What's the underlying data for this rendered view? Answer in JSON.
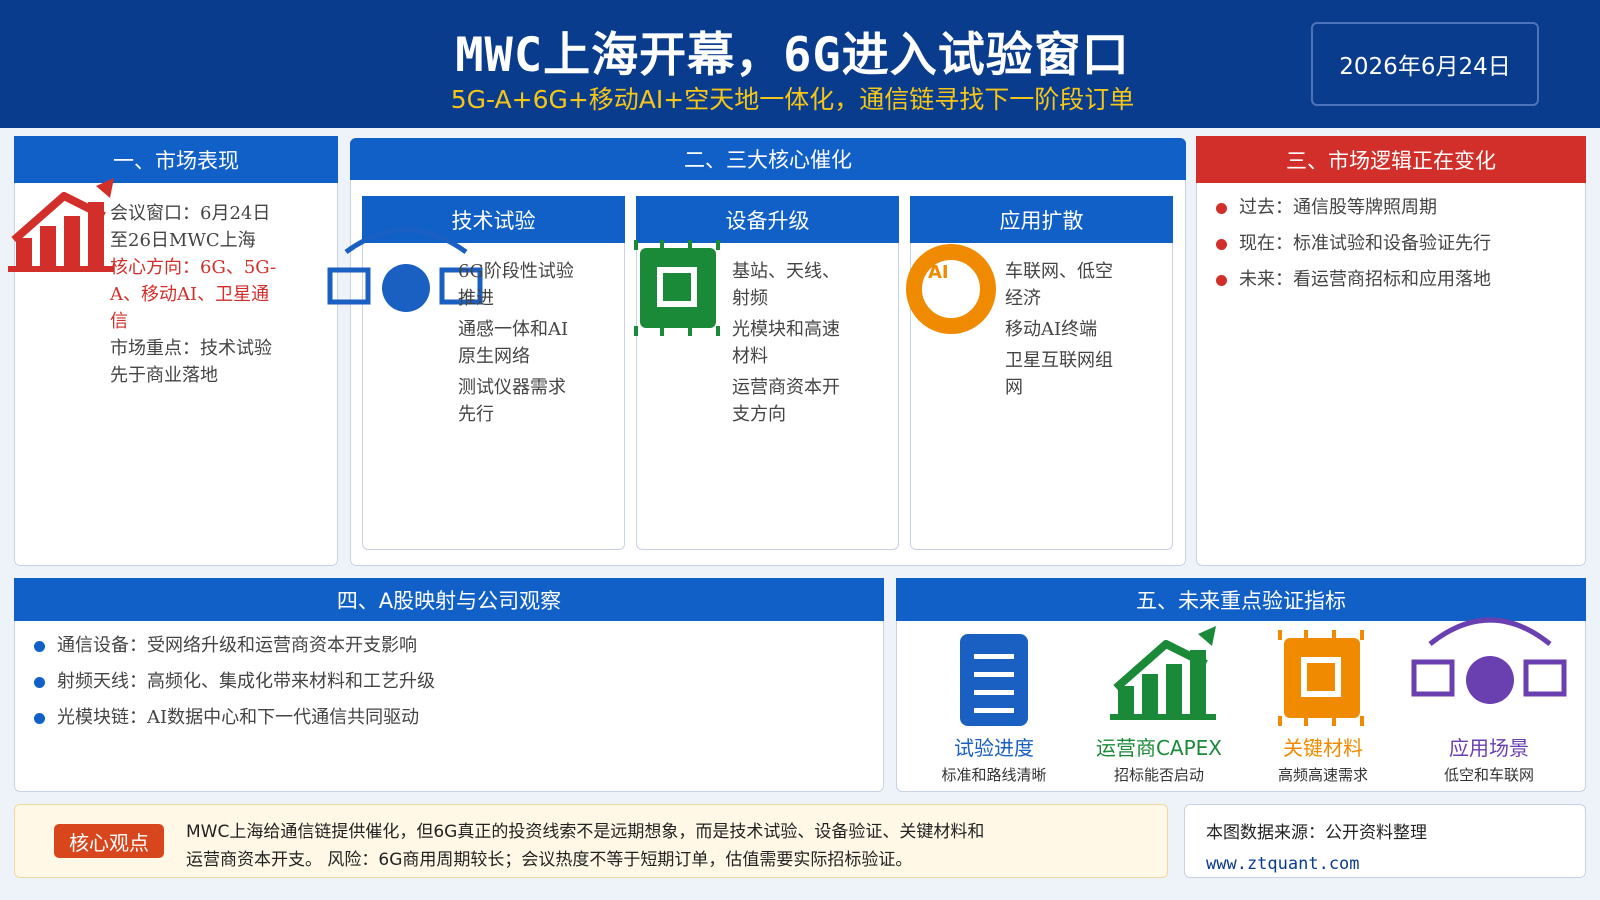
{
  "header": {
    "title": "MWC上海开幕，6G进入试验窗口",
    "subtitle": "5G-A+6G+移动AI+空天地一体化，通信链寻找下一阶段订单",
    "date": "2026年6月24日"
  },
  "section1": {
    "title": "一、市场表现",
    "icon": "bar-chart-up-icon",
    "lines": [
      {
        "text": "会议窗口：6月24日至26日MWC上海",
        "highlight": false
      },
      {
        "text": "核心方向：6G、5G-A、移动AI、卫星通信",
        "highlight": true
      },
      {
        "text": "市场重点：技术试验先于商业落地",
        "highlight": false
      }
    ]
  },
  "section2": {
    "title": "二、三大核心催化",
    "cards": [
      {
        "title": "技术试验",
        "icon": "network-nodes-icon",
        "items": [
          "6G阶段性试验推进",
          "通感一体和AI原生网络",
          "测试仪器需求先行"
        ]
      },
      {
        "title": "设备升级",
        "icon": "chip-icon",
        "items": [
          "基站、天线、射频",
          "光模块和高速材料",
          "运营商资本开支方向"
        ]
      },
      {
        "title": "应用扩散",
        "icon": "ai-badge-icon",
        "icon_text": "AI",
        "items": [
          "车联网、低空经济",
          "移动AI终端",
          "卫星互联网组网"
        ]
      }
    ]
  },
  "section3": {
    "title": "三、市场逻辑正在变化",
    "items": [
      "过去：通信股等牌照周期",
      "现在：标准试验和设备验证先行",
      "未来：看运营商招标和应用落地"
    ]
  },
  "section4": {
    "title": "四、A股映射与公司观察",
    "items": [
      "通信设备：受网络升级和运营商资本开支影响",
      "射频天线：高频化、集成化带来材料和工艺升级",
      "光模块链：AI数据中心和下一代通信共同驱动"
    ]
  },
  "section5": {
    "title": "五、未来重点验证指标",
    "metrics": [
      {
        "label": "试验进度",
        "sub": "标准和路线清晰",
        "icon": "document-icon",
        "color": "#1a5fc2"
      },
      {
        "label": "运营商CAPEX",
        "sub": "招标能否启动",
        "icon": "bar-chart-up-icon",
        "color": "#1a8a38"
      },
      {
        "label": "关键材料",
        "sub": "高频高速需求",
        "icon": "chip-icon",
        "color": "#f08a00"
      },
      {
        "label": "应用场景",
        "sub": "低空和车联网",
        "icon": "network-nodes-icon",
        "color": "#6a3fb0"
      }
    ]
  },
  "footer": {
    "badge": "核心观点",
    "text1": "MWC上海给通信链提供催化，但6G真正的投资线索不是远期想象，而是技术试验、设备验证、关键材料和",
    "text2": "运营商资本开支。 风险：6G商用周期较长；会议热度不等于短期订单，估值需要实际招标验证。",
    "source": "本图数据来源：公开资料整理",
    "url": "www.ztquant.com"
  },
  "colors": {
    "navy": "#093c8c",
    "blue": "#1060c8",
    "red": "#d22f2b",
    "gold": "#f5c518",
    "green": "#1a8a38",
    "orange": "#f08a00",
    "purple": "#6a3fb0"
  }
}
